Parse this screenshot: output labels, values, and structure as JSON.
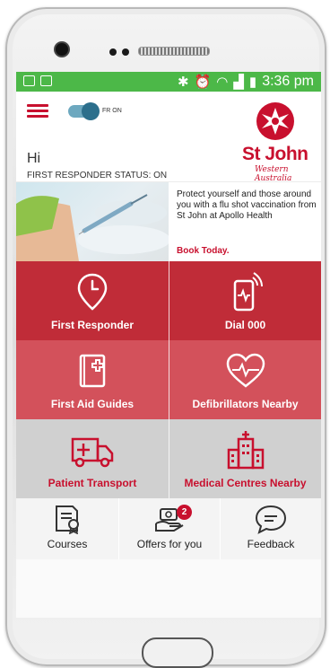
{
  "status_bar": {
    "time": "3:36 pm"
  },
  "header": {
    "toggle_label": "FR ON",
    "logo_name": "St John",
    "logo_subtitle": "Western Australia",
    "greeting": "Hi",
    "responder_status": "FIRST RESPONDER STATUS: ON"
  },
  "promo": {
    "text": "Protect yourself and those around you with a flu shot vaccination from St John at Apollo Health",
    "cta": "Book Today."
  },
  "tiles": [
    {
      "label": "First Responder",
      "icon": "clock-pin-icon"
    },
    {
      "label": "Dial 000",
      "icon": "phone-call-icon"
    },
    {
      "label": "First Aid Guides",
      "icon": "first-aid-book-icon"
    },
    {
      "label": "Defibrillators Nearby",
      "icon": "heartbeat-icon"
    },
    {
      "label": "Patient Transport",
      "icon": "ambulance-icon"
    },
    {
      "label": "Medical Centres Nearby",
      "icon": "hospital-building-icon"
    }
  ],
  "bottom_nav": [
    {
      "label": "Courses",
      "icon": "certificate-icon"
    },
    {
      "label": "Offers for you",
      "icon": "offers-hand-icon",
      "badge": "2"
    },
    {
      "label": "Feedback",
      "icon": "chat-bubble-icon"
    }
  ],
  "colors": {
    "brand_red": "#c8102e",
    "status_green": "#4cb848",
    "tile_dark": "#c02c38",
    "tile_mid": "#d3515b",
    "tile_light": "#d0d0d0"
  }
}
